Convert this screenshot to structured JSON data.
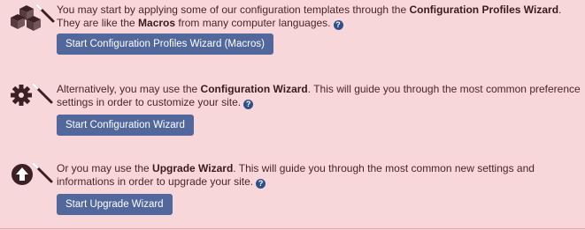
{
  "wizards": [
    {
      "icon": "boxes-wand-icon",
      "text_before": "You may start by applying some of our configuration templates through the ",
      "bold": "Configuration Profiles Wizard",
      "text_middle": ". They are like the ",
      "bold2": "Macros",
      "text_after": " from many computer languages.",
      "button": "Start Configuration Profiles Wizard (Macros)"
    },
    {
      "icon": "gear-wand-icon",
      "text_before": "Alternatively, you may use the ",
      "bold": "Configuration Wizard",
      "text_after": ". This will guide you through the most common preference settings in order to customize your site.",
      "button": "Start Configuration Wizard"
    },
    {
      "icon": "upgrade-wand-icon",
      "text_before": "Or you may use the ",
      "bold": "Upgrade Wizard",
      "text_after": ". This will guide you through the most common new settings and informations in order to upgrade your site.",
      "button": "Start Upgrade Wizard"
    }
  ],
  "help_glyph": "?",
  "colors": {
    "background": "#f8d7da",
    "button": "#52679c",
    "help": "#2d4f8a",
    "text": "#4a2528"
  }
}
